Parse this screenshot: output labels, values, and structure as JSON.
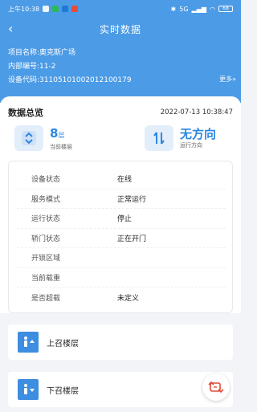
{
  "status_bar": {
    "time": "上午10:38",
    "battery": "68",
    "network": "5G"
  },
  "nav": {
    "title": "实时数据"
  },
  "project": {
    "name_label": "项目名称:",
    "name": "奥克斯广场",
    "code_label": "内部编号:",
    "code": "11-2",
    "device_label": "设备代码:",
    "device": "31105101002012100179",
    "more": "更多»"
  },
  "overview": {
    "title": "数据总览",
    "timestamp": "2022-07-13 10:38:47",
    "floor_value": "8",
    "floor_unit": "层",
    "floor_label": "当前楼层",
    "direction_value": "无方向",
    "direction_label": "运行方向"
  },
  "status_rows": [
    {
      "key": "设备状态",
      "value": "在线"
    },
    {
      "key": "服务模式",
      "value": "正常运行"
    },
    {
      "key": "运行状态",
      "value": "停止"
    },
    {
      "key": "轿门状态",
      "value": "正在开门"
    },
    {
      "key": "开锁区域",
      "value": ""
    },
    {
      "key": "当前载重",
      "value": ""
    },
    {
      "key": "是否超载",
      "value": "未定义"
    }
  ],
  "calls": {
    "up_label": "上召楼层",
    "down_label": "下召楼层"
  },
  "colors": {
    "primary": "#4b9be6",
    "accent": "#2c86e0",
    "fab_icon": "#e14b3b"
  }
}
